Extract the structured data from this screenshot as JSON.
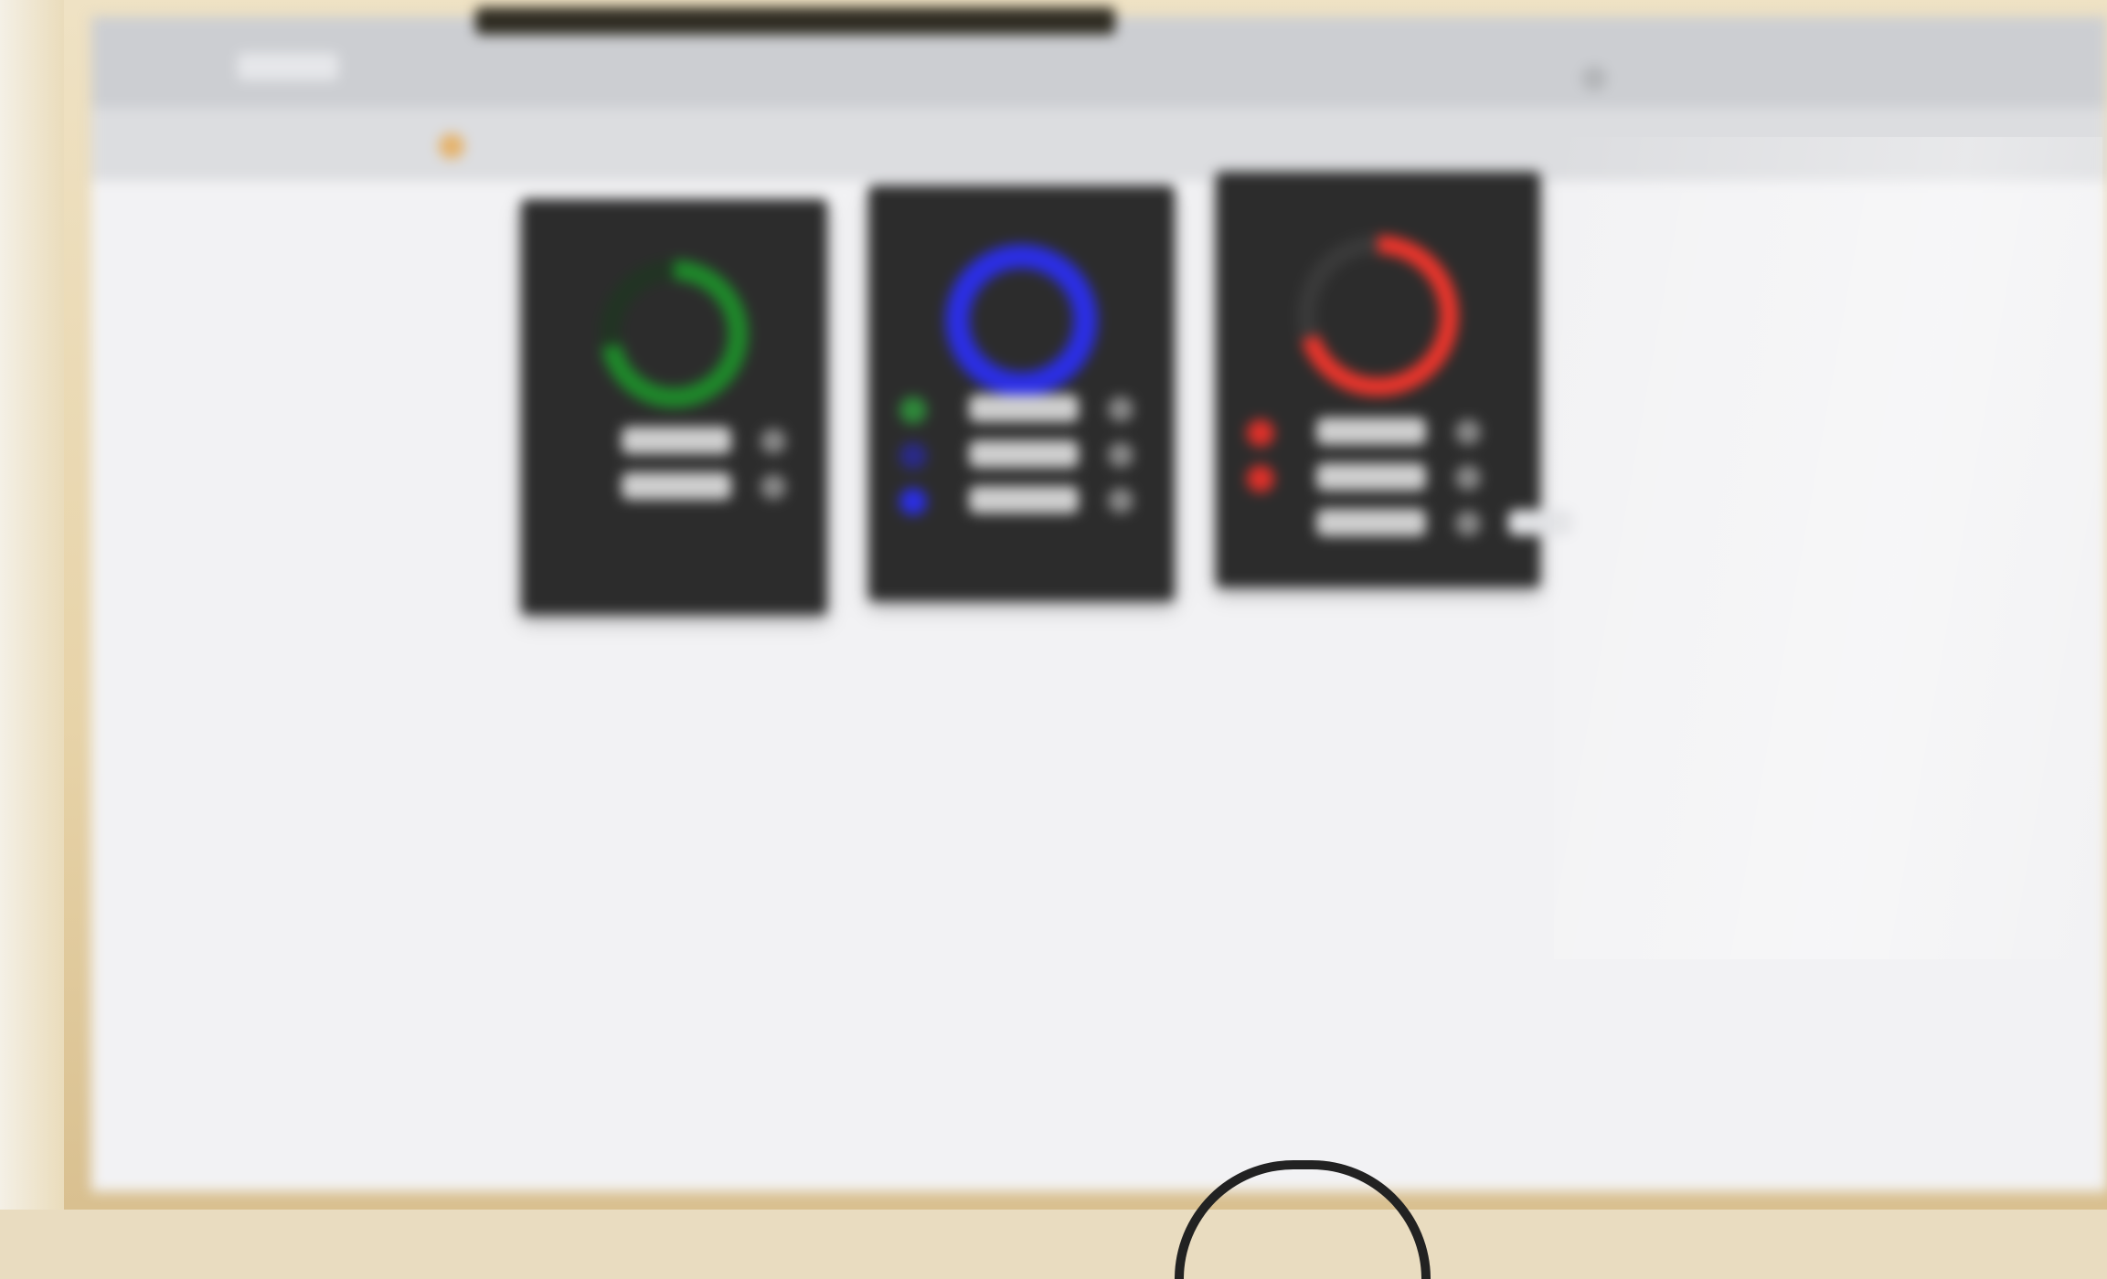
{
  "topbar": {
    "brand": "",
    "right_items": [
      "",
      "",
      ""
    ]
  },
  "subnav": {
    "links": [
      "",
      "",
      ""
    ]
  },
  "cards": [
    {
      "title": "",
      "ring_color": "#1e8a2a",
      "ring_track_color": "#1b3a1e",
      "ring_fraction": 0.72,
      "rows": [
        {
          "bullet_color": "",
          "label": "",
          "value": ""
        },
        {
          "bullet_color": "",
          "label": "",
          "value": ""
        }
      ]
    },
    {
      "title": "",
      "ring_color": "#2b2ee6",
      "ring_track_color": "#2b2ee6",
      "ring_fraction": 1.0,
      "rows": [
        {
          "bullet_color": "#2e8a3a",
          "label": "",
          "value": ""
        },
        {
          "bullet_color": "#2a2a8a",
          "label": "",
          "value": ""
        },
        {
          "bullet_color": "#2b2ee6",
          "label": "",
          "value": ""
        }
      ]
    },
    {
      "title": "",
      "ring_color": "#f0352c",
      "ring_track_color": "#444444",
      "ring_fraction": 0.7,
      "rows": [
        {
          "bullet_color": "#e0302a",
          "label": "",
          "value": ""
        },
        {
          "bullet_color": "#e0302a",
          "label": "",
          "value": ""
        },
        {
          "bullet_color": "",
          "label": "",
          "value": ""
        }
      ]
    }
  ],
  "export_label": "",
  "tabs": [
    {
      "label": "",
      "active": false
    },
    {
      "label": "",
      "active": false
    },
    {
      "label": "",
      "active": true
    },
    {
      "label": "",
      "active": false
    }
  ],
  "table": {
    "columns": [
      "",
      "",
      "",
      ""
    ],
    "rows": [
      [
        "",
        "",
        "",
        ""
      ],
      [
        "",
        "",
        "",
        ""
      ],
      [
        "",
        "",
        "",
        ""
      ],
      [
        "",
        "",
        "",
        ""
      ]
    ]
  }
}
